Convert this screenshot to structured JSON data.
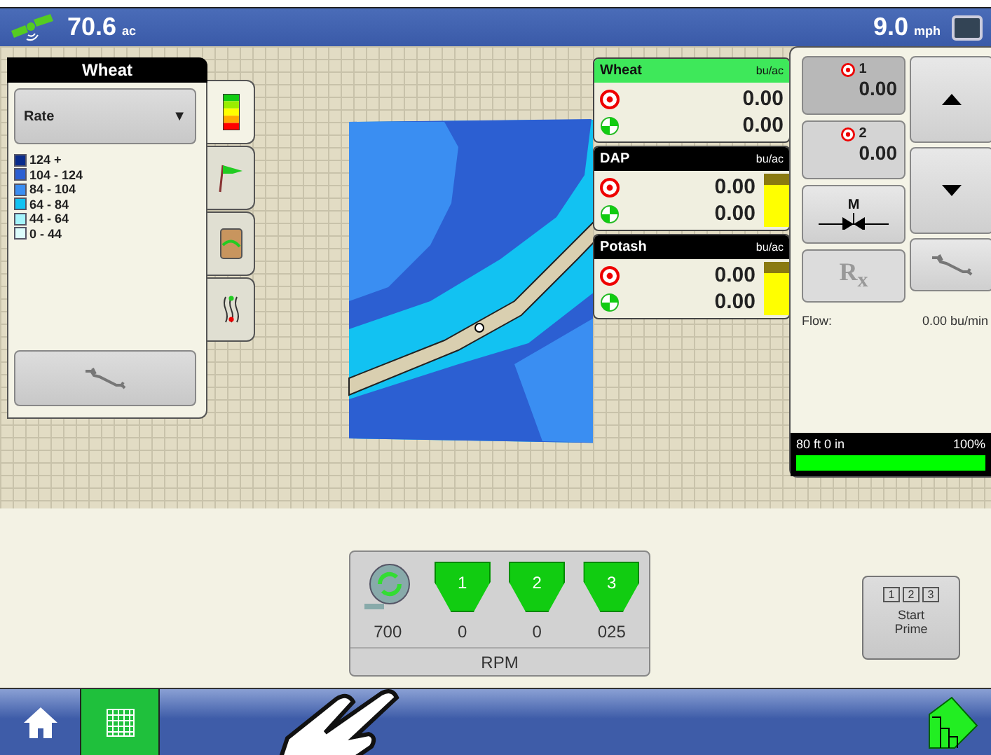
{
  "top_bar": {
    "area": "70.6",
    "area_unit": "ac",
    "speed": "9.0",
    "speed_unit": "mph"
  },
  "legend_panel": {
    "title": "Wheat",
    "dropdown": "Rate",
    "dropdown_arrow": "▼",
    "ranges": [
      {
        "label": "124 +",
        "color": "#0a2c8c"
      },
      {
        "label": "104 - 124",
        "color": "#2c5fd2"
      },
      {
        "label": "84 - 104",
        "color": "#3a8ef2"
      },
      {
        "label": "64 - 84",
        "color": "#12c2f2"
      },
      {
        "label": "44 - 64",
        "color": "#a4f4fc"
      },
      {
        "label": "0 - 44",
        "color": "#dcfcfc"
      }
    ],
    "tabs": [
      {
        "kind": "rate",
        "selected": true
      },
      {
        "kind": "flag",
        "selected": false
      },
      {
        "kind": "boundary",
        "selected": false
      },
      {
        "kind": "guidance",
        "selected": false
      }
    ]
  },
  "products": [
    {
      "name": "Wheat",
      "unit": "bu/ac",
      "target": "0.00",
      "actual": "0.00",
      "selected": true
    },
    {
      "name": "DAP",
      "unit": "bu/ac",
      "target": "0.00",
      "actual": "0.00",
      "selected": false,
      "level": 0.78
    },
    {
      "name": "Potash",
      "unit": "bu/ac",
      "target": "0.00",
      "actual": "0.00",
      "selected": false,
      "level": 0.78
    }
  ],
  "rate_panel": {
    "presets": [
      {
        "label": "1",
        "value": "0.00",
        "selected": true
      },
      {
        "label": "2",
        "value": "0.00",
        "selected": false
      }
    ],
    "manual_label": "M",
    "rx_label": "R$_{x}$",
    "flow_label": "Flow:",
    "flow_value": "0.00 bu/min",
    "width": "80 ft 0 in",
    "coverage": "100%",
    "level": 1.0
  },
  "meters": {
    "bins": [
      "1",
      "2",
      "3"
    ],
    "values": [
      "700",
      "0",
      "0",
      "025"
    ],
    "unit": "RPM"
  },
  "prime": {
    "bins": [
      "1",
      "2",
      "3"
    ],
    "label": "Start Prime"
  },
  "nav": [
    {
      "kind": "home",
      "selected": false
    },
    {
      "kind": "map",
      "selected": true
    }
  ]
}
